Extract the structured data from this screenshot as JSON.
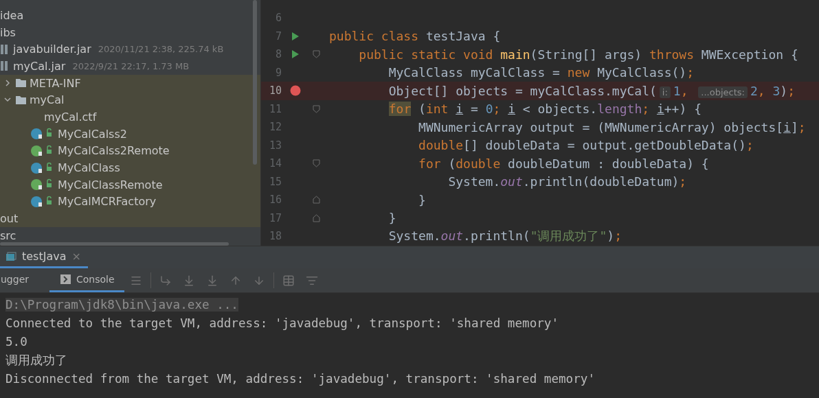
{
  "project": {
    "items": [
      {
        "label": "idea",
        "highlighted": false
      },
      {
        "label": "ibs",
        "highlighted": false,
        "children": [
          {
            "label": "javabuilder.jar",
            "meta": "2020/11/21 2:38, 225.74 kB",
            "kind": "jar",
            "highlighted": false
          },
          {
            "label": "myCal.jar",
            "meta": "2022/9/21 22:17, 1.73 MB",
            "kind": "jar",
            "highlighted": false,
            "children": [
              {
                "label": "META-INF",
                "kind": "folder",
                "highlighted": true,
                "expanded": false
              },
              {
                "label": "myCal",
                "kind": "folder",
                "highlighted": true,
                "expanded": true,
                "children": [
                  {
                    "label": "myCal.ctf",
                    "kind": "file",
                    "highlighted": true
                  },
                  {
                    "label": "MyCalCalss2",
                    "kind": "class",
                    "highlighted": true
                  },
                  {
                    "label": "MyCalCalss2Remote",
                    "kind": "interface",
                    "highlighted": true
                  },
                  {
                    "label": "MyCalClass",
                    "kind": "class",
                    "highlighted": true
                  },
                  {
                    "label": "MyCalClassRemote",
                    "kind": "interface",
                    "highlighted": true
                  },
                  {
                    "label": "MyCalMCRFactory",
                    "kind": "class",
                    "highlighted": true
                  }
                ]
              }
            ]
          }
        ]
      },
      {
        "label": "out",
        "highlighted": true
      },
      {
        "label": "src",
        "highlighted": false
      }
    ]
  },
  "editor": {
    "lines": [
      {
        "number": "6",
        "runnable": false,
        "breakpoint": false,
        "fold_start": false,
        "fold_end": false
      },
      {
        "number": "7",
        "runnable": true,
        "breakpoint": false,
        "fold_start": false,
        "fold_end": false,
        "tokens": [
          {
            "kind": "kw",
            "text": "public class "
          },
          {
            "kind": "plain",
            "text": "testJava {"
          }
        ]
      },
      {
        "number": "8",
        "runnable": true,
        "breakpoint": false,
        "fold_start": true,
        "fold_end": false,
        "tokens": [
          {
            "kind": "kw",
            "text": "    public static void "
          },
          {
            "kind": "fn",
            "text": "main"
          },
          {
            "kind": "plain",
            "text": "(String[] args) "
          },
          {
            "kind": "kw",
            "text": "throws "
          },
          {
            "kind": "plain",
            "text": "MWException {"
          }
        ]
      },
      {
        "number": "9",
        "runnable": false,
        "breakpoint": false,
        "fold_start": false,
        "fold_end": false,
        "tokens": [
          {
            "kind": "plain",
            "text": "        MyCalClass myCalClass = "
          },
          {
            "kind": "kw",
            "text": "new "
          },
          {
            "kind": "plain",
            "text": "MyCalClass()"
          },
          {
            "kind": "kw",
            "text": ";"
          }
        ]
      },
      {
        "number": "10",
        "runnable": false,
        "breakpoint": true,
        "fold_start": false,
        "fold_end": false,
        "tokens": [
          {
            "kind": "plain",
            "text": "        Object[] objects = myCalClass.myCal("
          },
          {
            "kind": "hint",
            "text": "i:"
          },
          {
            "kind": "num",
            "text": "1"
          },
          {
            "kind": "kw",
            "text": ", "
          },
          {
            "kind": "hint",
            "text": "...objects:"
          },
          {
            "kind": "num",
            "text": "2"
          },
          {
            "kind": "kw",
            "text": ", "
          },
          {
            "kind": "num",
            "text": "3"
          },
          {
            "kind": "plain",
            "text": ")"
          },
          {
            "kind": "kw",
            "text": ";"
          }
        ]
      },
      {
        "number": "11",
        "runnable": false,
        "breakpoint": false,
        "fold_start": true,
        "fold_end": false,
        "tokens": [
          {
            "kind": "kwhl",
            "text": "        for"
          },
          {
            "kind": "plain",
            "text": " ("
          },
          {
            "kind": "kw",
            "text": "int "
          },
          {
            "kind": "var",
            "text": "i"
          },
          {
            "kind": "plain",
            "text": " = "
          },
          {
            "kind": "num",
            "text": "0"
          },
          {
            "kind": "kw",
            "text": "; "
          },
          {
            "kind": "var",
            "text": "i"
          },
          {
            "kind": "plain",
            "text": " < objects."
          },
          {
            "kind": "prop",
            "text": "length"
          },
          {
            "kind": "kw",
            "text": "; "
          },
          {
            "kind": "var",
            "text": "i"
          },
          {
            "kind": "plain",
            "text": "++) {"
          }
        ]
      },
      {
        "number": "12",
        "runnable": false,
        "breakpoint": false,
        "fold_start": false,
        "fold_end": false,
        "tokens": [
          {
            "kind": "plain",
            "text": "            MWNumericArray output = (MWNumericArray) objects["
          },
          {
            "kind": "var",
            "text": "i"
          },
          {
            "kind": "plain",
            "text": "]"
          },
          {
            "kind": "kw",
            "text": ";"
          }
        ]
      },
      {
        "number": "13",
        "runnable": false,
        "breakpoint": false,
        "fold_start": false,
        "fold_end": false,
        "tokens": [
          {
            "kind": "kw",
            "text": "            double"
          },
          {
            "kind": "plain",
            "text": "[] doubleData = output.getDoubleData()"
          },
          {
            "kind": "kw",
            "text": ";"
          }
        ]
      },
      {
        "number": "14",
        "runnable": false,
        "breakpoint": false,
        "fold_start": true,
        "fold_end": false,
        "tokens": [
          {
            "kind": "kw",
            "text": "            for "
          },
          {
            "kind": "plain",
            "text": "("
          },
          {
            "kind": "kw",
            "text": "double "
          },
          {
            "kind": "plain",
            "text": "doubleDatum : doubleData) {"
          }
        ]
      },
      {
        "number": "15",
        "runnable": false,
        "breakpoint": false,
        "fold_start": false,
        "fold_end": false,
        "tokens": [
          {
            "kind": "plain",
            "text": "                System."
          },
          {
            "kind": "field",
            "text": "out"
          },
          {
            "kind": "plain",
            "text": ".println(doubleDatum)"
          },
          {
            "kind": "kw",
            "text": ";"
          }
        ]
      },
      {
        "number": "16",
        "runnable": false,
        "breakpoint": false,
        "fold_start": false,
        "fold_end": true,
        "tokens": [
          {
            "kind": "plain",
            "text": "            }"
          }
        ]
      },
      {
        "number": "17",
        "runnable": false,
        "breakpoint": false,
        "fold_start": false,
        "fold_end": true,
        "tokens": [
          {
            "kind": "plain",
            "text": "        }"
          }
        ]
      },
      {
        "number": "18",
        "runnable": false,
        "breakpoint": false,
        "fold_start": false,
        "fold_end": false,
        "tokens": [
          {
            "kind": "plain",
            "text": "        System."
          },
          {
            "kind": "field",
            "text": "out"
          },
          {
            "kind": "plain",
            "text": ".println("
          },
          {
            "kind": "str",
            "text": "\"调用成功了\""
          },
          {
            "kind": "plain",
            "text": ")"
          },
          {
            "kind": "kw",
            "text": ";"
          }
        ]
      }
    ]
  },
  "run_panel": {
    "tabs": [
      {
        "label": "testJava",
        "selected": true,
        "close": "×"
      }
    ],
    "subtabs": [
      {
        "label": "ugger",
        "selected": false
      },
      {
        "label": "Console",
        "selected": true
      }
    ],
    "console": [
      {
        "kind": "command",
        "text": "D:\\Program\\jdk8\\bin\\java.exe ..."
      },
      {
        "kind": "output",
        "text": "Connected to the target VM, address: 'javadebug', transport: 'shared memory'"
      },
      {
        "kind": "output",
        "text": "5.0"
      },
      {
        "kind": "output",
        "text": "调用成功了"
      },
      {
        "kind": "output",
        "text": "Disconnected from the target VM, address: 'javadebug', transport: 'shared memory'"
      }
    ]
  }
}
